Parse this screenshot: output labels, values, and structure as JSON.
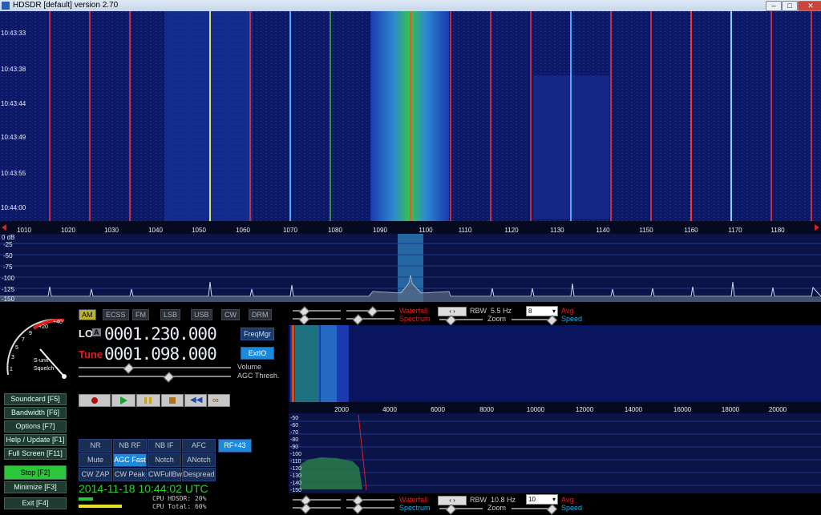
{
  "window": {
    "title": "HDSDR [default]  version 2.70",
    "min": "–",
    "max": "□",
    "close": "✕"
  },
  "waterfall": {
    "times": [
      "10:43:33",
      "10:43:38",
      "10:43:44",
      "10:43:49",
      "10:43:55",
      "10:44:00"
    ],
    "freq_ticks": [
      "1010",
      "1020",
      "1030",
      "1040",
      "1050",
      "1060",
      "1070",
      "1080",
      "1090",
      "1100",
      "1110",
      "1120",
      "1130",
      "1140",
      "1150",
      "1160",
      "1170",
      "1180"
    ]
  },
  "spectrum": {
    "db_ticks": [
      "0 dB",
      "-25",
      "-50",
      "-75",
      "-100",
      "-125",
      "-150"
    ]
  },
  "smeter": {
    "labels": [
      "1",
      "3",
      "5",
      "7",
      "9",
      "+20",
      "+40"
    ],
    "unit": "S-unit",
    "mode": "Squelch"
  },
  "modes": [
    "AM",
    "ECSS",
    "FM",
    "LSB",
    "USB",
    "CW",
    "DRM"
  ],
  "lo": {
    "label": "LO",
    "sub": "A",
    "value": "0001.230.000"
  },
  "tune": {
    "label": "Tune",
    "value": "0001.098.000"
  },
  "buttons": {
    "freqmgr": "FreqMgr",
    "extio": "ExtIO"
  },
  "sliders": {
    "volume": "Volume",
    "agc": "AGC Thresh."
  },
  "side": [
    "Soundcard    [F5]",
    "Bandwidth   [F6]",
    "Options     [F7]",
    "Help / Update [F1]",
    "Full Screen [F11]",
    "Stop      [F2]",
    "Minimize  [F3]",
    "Exit        [F4]"
  ],
  "dsp": {
    "row1": [
      "NR",
      "NB RF",
      "NB IF",
      "AFC",
      "RF+43"
    ],
    "row2": [
      "Mute",
      "AGC Fast",
      "Notch",
      "ANotch"
    ],
    "row3": [
      "CW ZAP",
      "CW Peak",
      "CWFullBw",
      "Despread"
    ]
  },
  "datetime": "2014-11-18   10:44:02 UTC",
  "cpu": {
    "hdsdr": "CPU HDSDR: 20%",
    "total": "CPU Total: 60%"
  },
  "rf_ctrl": {
    "waterfall": "Waterfall",
    "spectrum": "Spectrum",
    "rbw": "RBW",
    "rbw_val": "5.5 Hz",
    "avg_val": "8",
    "avg": "Avg",
    "zoom": "Zoom",
    "speed": "Speed"
  },
  "af_ctrl": {
    "waterfall": "Waterfall",
    "spectrum": "Spectrum",
    "rbw": "RBW",
    "rbw_val": "10.8 Hz",
    "avg_val": "10",
    "avg": "Avg",
    "zoom": "Zoom",
    "speed": "Speed"
  },
  "af_freq_ticks": [
    "2000",
    "4000",
    "6000",
    "8000",
    "10000",
    "12000",
    "14000",
    "16000",
    "18000",
    "20000"
  ],
  "af_db_ticks": [
    "-50",
    "-60",
    "-70",
    "-80",
    "-90",
    "-100",
    "-110",
    "-120",
    "-130",
    "-140",
    "-150"
  ]
}
